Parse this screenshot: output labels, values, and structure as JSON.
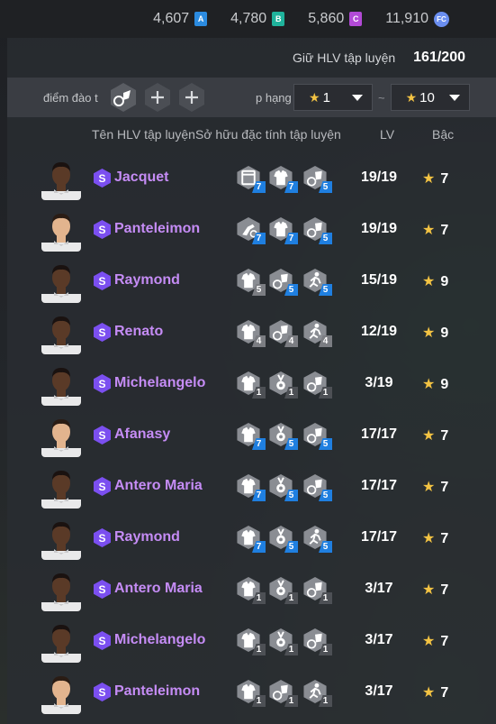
{
  "currencies": [
    {
      "value": "4,607",
      "badge": "A",
      "icon": "currency-a-icon"
    },
    {
      "value": "4,780",
      "badge": "B",
      "icon": "currency-b-icon"
    },
    {
      "value": "5,860",
      "badge": "C",
      "icon": "currency-c-icon"
    },
    {
      "value": "11,910",
      "badge": "FC",
      "icon": "fc-coin-icon"
    }
  ],
  "hold": {
    "label": "Giữ HLV tập luyện",
    "value": "161/200"
  },
  "filter": {
    "label": "điểm đào t",
    "slots": [
      "training-trait-icon",
      "plus-icon",
      "plus-icon"
    ],
    "rank_label": "p hạng",
    "rank_min": "1",
    "rank_max": "10",
    "separator": "~"
  },
  "columns": {
    "name": "Tên HLV tập luyện",
    "traits": "Sở hữu đặc tính tập luyện",
    "lv": "LV",
    "grade": "Bậc"
  },
  "rows": [
    {
      "badge": "S",
      "name": "Jacquet",
      "skin": "dark",
      "traits": [
        {
          "icon": "card-trait-icon",
          "lv": "7",
          "tier": "blue"
        },
        {
          "icon": "shirt-trait-icon",
          "lv": "7",
          "tier": "blue"
        },
        {
          "icon": "ball-trait-icon",
          "lv": "5",
          "tier": "blue"
        }
      ],
      "lv": "19/19",
      "grade": "7"
    },
    {
      "badge": "S",
      "name": "Panteleimon",
      "skin": "light",
      "traits": [
        {
          "icon": "kick-trait-icon",
          "lv": "7",
          "tier": "blue"
        },
        {
          "icon": "shirt-trait-icon",
          "lv": "7",
          "tier": "blue"
        },
        {
          "icon": "ball-trait-icon",
          "lv": "5",
          "tier": "blue"
        }
      ],
      "lv": "19/19",
      "grade": "7"
    },
    {
      "badge": "S",
      "name": "Raymond",
      "skin": "dark",
      "traits": [
        {
          "icon": "shirt-trait-icon",
          "lv": "5",
          "tier": "grey"
        },
        {
          "icon": "ball-trait-icon",
          "lv": "5",
          "tier": "blue"
        },
        {
          "icon": "runner-trait-icon",
          "lv": "5",
          "tier": "blue"
        }
      ],
      "lv": "15/19",
      "grade": "9"
    },
    {
      "badge": "S",
      "name": "Renato",
      "skin": "dark",
      "traits": [
        {
          "icon": "shirt-trait-icon",
          "lv": "4",
          "tier": "grey"
        },
        {
          "icon": "ball-trait-icon",
          "lv": "4",
          "tier": "grey"
        },
        {
          "icon": "runner-trait-icon",
          "lv": "4",
          "tier": "grey"
        }
      ],
      "lv": "12/19",
      "grade": "9"
    },
    {
      "badge": "S",
      "name": "Michelangelo",
      "skin": "dark",
      "traits": [
        {
          "icon": "shirt-trait-icon",
          "lv": "1",
          "tier": "dark"
        },
        {
          "icon": "medal-trait-icon",
          "lv": "1",
          "tier": "dark"
        },
        {
          "icon": "ball-trait-icon",
          "lv": "1",
          "tier": "dark"
        }
      ],
      "lv": "3/19",
      "grade": "9"
    },
    {
      "badge": "S",
      "name": "Afanasy",
      "skin": "light",
      "traits": [
        {
          "icon": "shirt-trait-icon",
          "lv": "7",
          "tier": "blue"
        },
        {
          "icon": "medal-trait-icon",
          "lv": "5",
          "tier": "blue"
        },
        {
          "icon": "ball-trait-icon",
          "lv": "5",
          "tier": "blue"
        }
      ],
      "lv": "17/17",
      "grade": "7"
    },
    {
      "badge": "S",
      "name": "Antero Maria",
      "skin": "dark",
      "traits": [
        {
          "icon": "shirt-trait-icon",
          "lv": "7",
          "tier": "blue"
        },
        {
          "icon": "medal-trait-icon",
          "lv": "5",
          "tier": "blue"
        },
        {
          "icon": "ball-trait-icon",
          "lv": "5",
          "tier": "blue"
        }
      ],
      "lv": "17/17",
      "grade": "7"
    },
    {
      "badge": "S",
      "name": "Raymond",
      "skin": "dark",
      "traits": [
        {
          "icon": "shirt-trait-icon",
          "lv": "7",
          "tier": "blue"
        },
        {
          "icon": "medal-trait-icon",
          "lv": "5",
          "tier": "blue"
        },
        {
          "icon": "runner-trait-icon",
          "lv": "5",
          "tier": "blue"
        }
      ],
      "lv": "17/17",
      "grade": "7"
    },
    {
      "badge": "S",
      "name": "Antero Maria",
      "skin": "dark",
      "traits": [
        {
          "icon": "shirt-trait-icon",
          "lv": "1",
          "tier": "dark"
        },
        {
          "icon": "medal-trait-icon",
          "lv": "1",
          "tier": "dark"
        },
        {
          "icon": "ball-trait-icon",
          "lv": "1",
          "tier": "dark"
        }
      ],
      "lv": "3/17",
      "grade": "7"
    },
    {
      "badge": "S",
      "name": "Michelangelo",
      "skin": "dark",
      "traits": [
        {
          "icon": "shirt-trait-icon",
          "lv": "1",
          "tier": "dark"
        },
        {
          "icon": "medal-trait-icon",
          "lv": "1",
          "tier": "dark"
        },
        {
          "icon": "ball-trait-icon",
          "lv": "1",
          "tier": "dark"
        }
      ],
      "lv": "3/17",
      "grade": "7"
    },
    {
      "badge": "S",
      "name": "Panteleimon",
      "skin": "light",
      "traits": [
        {
          "icon": "shirt-trait-icon",
          "lv": "1",
          "tier": "dark"
        },
        {
          "icon": "ball-trait-icon",
          "lv": "1",
          "tier": "dark"
        },
        {
          "icon": "runner-trait-icon",
          "lv": "1",
          "tier": "dark"
        }
      ],
      "lv": "3/17",
      "grade": "7"
    }
  ]
}
